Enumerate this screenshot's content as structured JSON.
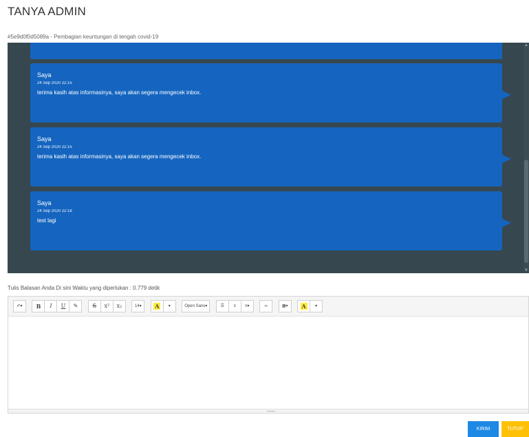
{
  "header": {
    "title": "TANYA ADMIN",
    "ticket": "#5e9d0f0d5089a - Pembagian keuntungan di tengah covid-19"
  },
  "chat": {
    "messages": [
      {
        "sender": "Saya",
        "time": "24 Sep 2020 22:15",
        "text": "terima kasih atas informasinya, saya akan segera mengecek inbox."
      },
      {
        "sender": "Saya",
        "time": "24 Sep 2020 22:15",
        "text": "terima kasih atas informasinya, saya akan segera mengecek inbox."
      },
      {
        "sender": "Saya",
        "time": "24 Sep 2020 22:18",
        "text": "test lagi"
      }
    ]
  },
  "reply": {
    "label": "Tulis Balasan Anda Di sini Waktu yang diperlukan : 0.779 detik"
  },
  "toolbar": {
    "style": "✐▾",
    "bold": "B",
    "italic": "I",
    "underline": "U",
    "eraser": "✎",
    "strikethrough": "S",
    "superscript": "x²",
    "subscript": "x₂",
    "font_size": "14▾",
    "color": "A",
    "color_caret": "▾",
    "font_name": "Open Sans▾",
    "bullet_list": "☰",
    "number_list": "≡",
    "paragraph": "≡▾",
    "link": "∞",
    "table": "▦▾",
    "highlight": "A",
    "highlight_caret": "▾"
  },
  "buttons": {
    "send": "KIRIM",
    "close": "TUTUP"
  },
  "colors": {
    "chat_bg": "#37474f",
    "bubble": "#1565c0",
    "send_button": "#1e88e5",
    "close_button": "#ffc107",
    "highlight": "#ffeb3b"
  }
}
